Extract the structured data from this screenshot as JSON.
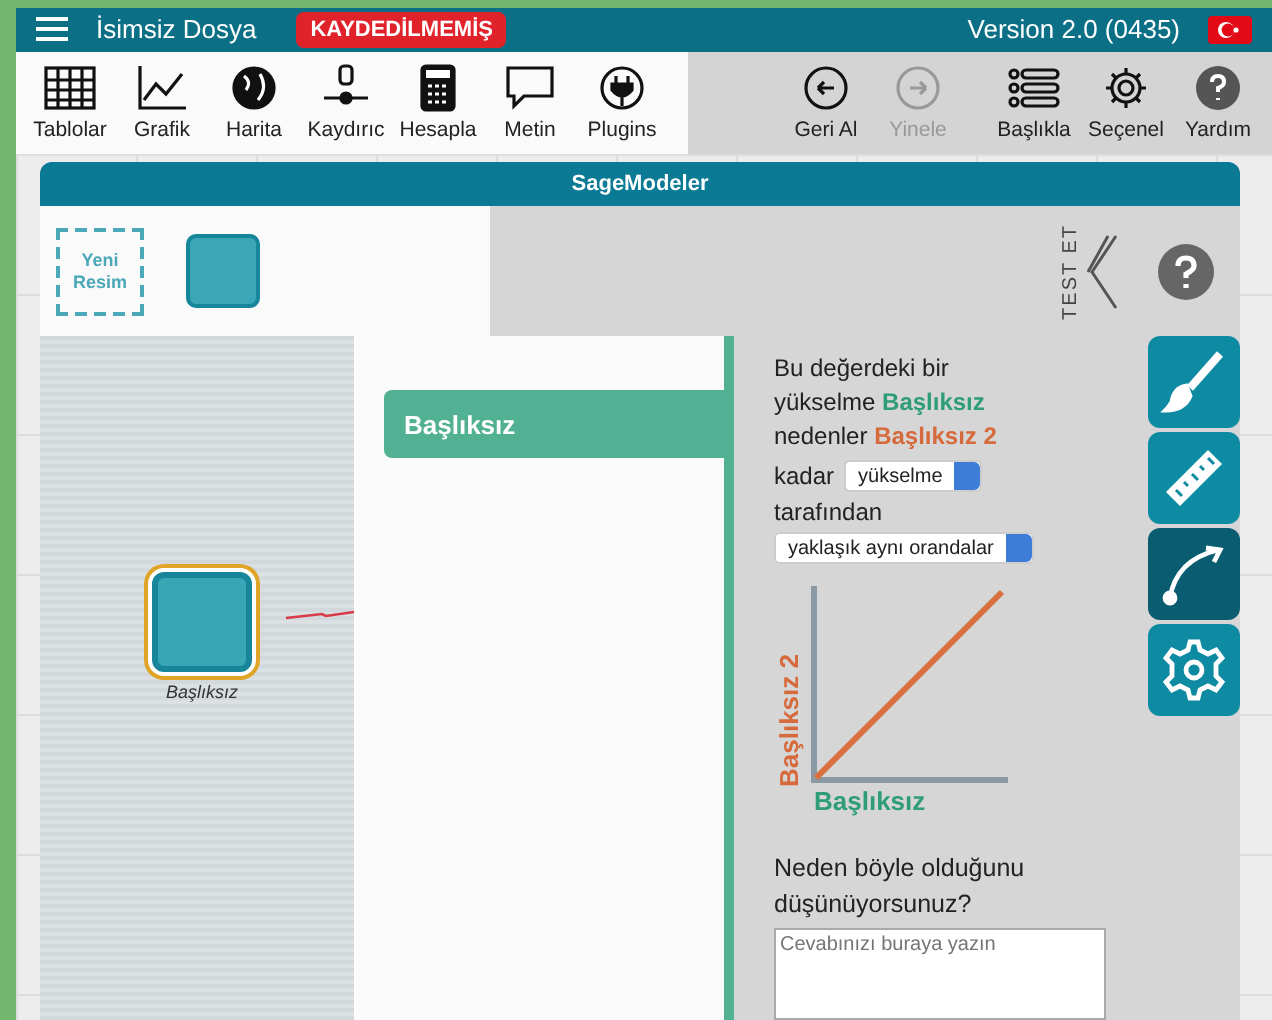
{
  "app_bar": {
    "title": "İsimsiz Dosya",
    "status_badge": "KAYDEDİLMEMİŞ",
    "version": "Version 2.0 (0435)"
  },
  "toolbar_left": [
    {
      "label": "Tablolar",
      "kind": "table"
    },
    {
      "label": "Grafik",
      "kind": "graph"
    },
    {
      "label": "Harita",
      "kind": "globe"
    },
    {
      "label": "Kaydırıc",
      "kind": "slider"
    },
    {
      "label": "Hesapla",
      "kind": "calculator"
    },
    {
      "label": "Metin",
      "kind": "text"
    },
    {
      "label": "Plugins",
      "kind": "plug"
    }
  ],
  "toolbar_right": [
    {
      "label": "Geri Al",
      "kind": "undo",
      "disabled": false
    },
    {
      "label": "Yinele",
      "kind": "redo",
      "disabled": true
    },
    {
      "label": "Başlıkla",
      "kind": "list",
      "disabled": false
    },
    {
      "label": "Seçenel",
      "kind": "gear",
      "disabled": false
    },
    {
      "label": "Yardım",
      "kind": "help",
      "disabled": false
    }
  ],
  "window": {
    "title": "SageModeler"
  },
  "palette": {
    "new_image": "Yeni Resim"
  },
  "test_toggle": "TEST ET",
  "canvas_nodes": [
    {
      "label": "Başlıksız",
      "selected": true
    }
  ],
  "link_panel": {
    "title": "Başlıksız"
  },
  "relationship": {
    "intro": "Bu değerdeki bir yükselme",
    "cause": "Başlıksız",
    "connector": "nedenler",
    "effect": "Başlıksız 2",
    "kadar": "kadar",
    "direction_select": "yükselme",
    "tarafindan": "tarafından",
    "amount_select": "yaklaşık aynı orandalar",
    "graph_y": "Başlıksız 2",
    "graph_x": "Başlıksız",
    "question": "Neden böyle olduğunu düşünüyorsunuz?",
    "answer_placeholder": "Cevabınızı buraya yazın"
  },
  "side_tools": [
    {
      "kind": "brush",
      "selected": false
    },
    {
      "kind": "ruler",
      "selected": false
    },
    {
      "kind": "link",
      "selected": true
    },
    {
      "kind": "gear",
      "selected": false
    }
  ]
}
